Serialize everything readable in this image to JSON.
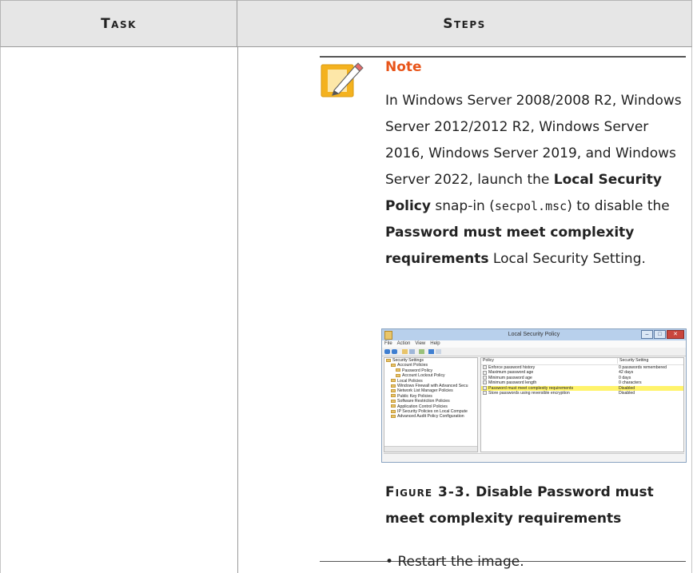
{
  "table": {
    "headers": {
      "task": "Task",
      "steps": "Steps"
    }
  },
  "note": {
    "label": "Note",
    "text_1": "In Windows Server 2008/2008 R2, Windows Server 2012/2012 R2, Windows Server 2016, Windows Server 2019, and Windows Server 2022, launch the ",
    "bold_1": "Local Security Policy",
    "text_2": " snap-in (",
    "code": "secpol.msc",
    "text_3": ") to disable the ",
    "bold_2": "Password must meet complexity requirements",
    "text_4": " Local Security Setting."
  },
  "screenshot": {
    "title": "Local Security Policy",
    "menu": [
      "File",
      "Action",
      "View",
      "Help"
    ],
    "tree": [
      {
        "label": "Security Settings",
        "indent": 0
      },
      {
        "label": "Account Policies",
        "indent": 1
      },
      {
        "label": "Password Policy",
        "indent": 2
      },
      {
        "label": "Account Lockout Policy",
        "indent": 2
      },
      {
        "label": "Local Policies",
        "indent": 1
      },
      {
        "label": "Windows Firewall with Advanced Secu",
        "indent": 1
      },
      {
        "label": "Network List Manager Policies",
        "indent": 1
      },
      {
        "label": "Public Key Policies",
        "indent": 1
      },
      {
        "label": "Software Restriction Policies",
        "indent": 1
      },
      {
        "label": "Application Control Policies",
        "indent": 1
      },
      {
        "label": "IP Security Policies on Local Compute",
        "indent": 1
      },
      {
        "label": "Advanced Audit Policy Configuration",
        "indent": 1
      }
    ],
    "columns": {
      "policy": "Policy",
      "setting": "Security Setting"
    },
    "policies": [
      {
        "policy": "Enforce password history",
        "setting": "0 passwords remembered",
        "selected": false
      },
      {
        "policy": "Maximum password age",
        "setting": "42 days",
        "selected": false
      },
      {
        "policy": "Minimum password age",
        "setting": "0 days",
        "selected": false
      },
      {
        "policy": "Minimum password length",
        "setting": "0 characters",
        "selected": false
      },
      {
        "policy": "Password must meet complexity requirements",
        "setting": "Disabled",
        "selected": true
      },
      {
        "policy": "Store passwords using reversible encryption",
        "setting": "Disabled",
        "selected": false
      }
    ]
  },
  "figure": {
    "number": "Figure 3-3.",
    "caption": "Disable Password must meet complexity requirements"
  },
  "bullet": "Restart the image."
}
